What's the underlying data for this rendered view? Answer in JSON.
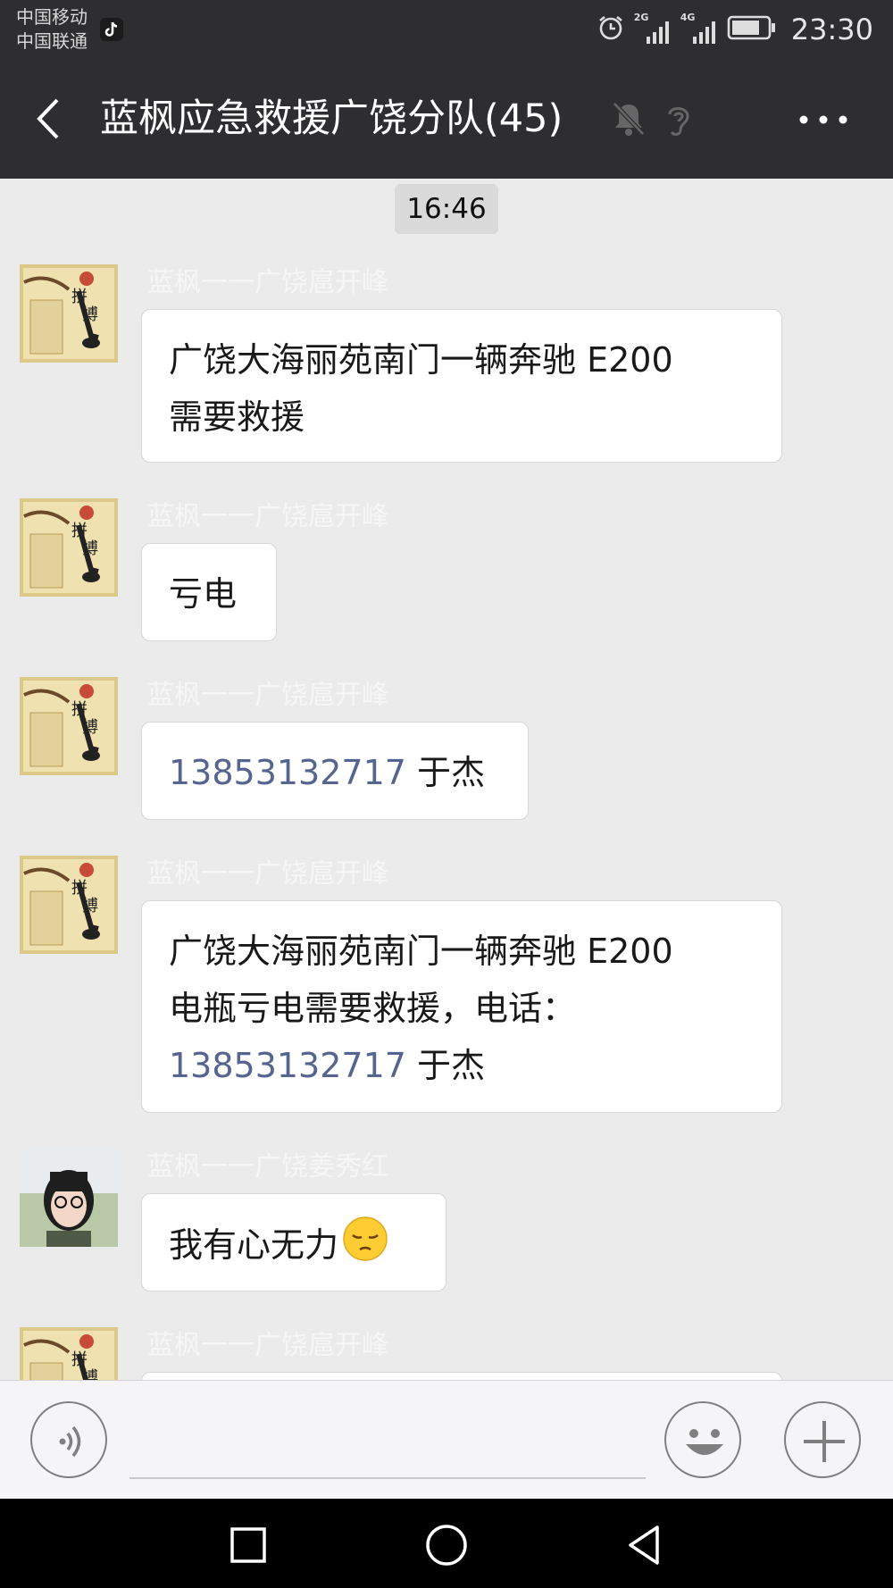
{
  "status_bar": {
    "carrier1": "中国移动",
    "carrier2": "中国联通",
    "net1": "2G",
    "net2": "4G",
    "time": "23:30",
    "icons": [
      "tiktok-icon",
      "alarm-icon",
      "signal-icon",
      "battery-icon"
    ]
  },
  "header": {
    "title": "蓝枫应急救援广饶分队(45)",
    "icons": [
      "back-arrow-icon",
      "mute-bell-icon",
      "earpiece-icon",
      "more-icon"
    ]
  },
  "chat": {
    "timestamp": "16:46",
    "messages": [
      {
        "sender": "蓝枫一一广饶扈开峰",
        "line1": "广饶大海丽苑南门一辆奔驰 E200",
        "line2": "需要救援"
      },
      {
        "sender": "蓝枫一一广饶扈开峰",
        "text": "亏电"
      },
      {
        "sender": "蓝枫一一广饶扈开峰",
        "phone": "13853132717",
        "suffix": " 于杰"
      },
      {
        "sender": "蓝枫一一广饶扈开峰",
        "line1": "广饶大海丽苑南门一辆奔驰 E200",
        "line2": "电瓶亏电需要救援，电话：",
        "phone": "13853132717",
        "suffix": " 于杰"
      },
      {
        "sender": "蓝枫一一广饶姜秀红",
        "text": "我有心无力",
        "emoji": "pensive-face"
      },
      {
        "sender": "蓝枫一一广饶扈开峰"
      }
    ]
  },
  "input_bar": {
    "text_value": "",
    "icons": [
      "voice-icon",
      "smiley-icon",
      "plus-icon"
    ]
  },
  "nav_bar": {
    "icons": [
      "recents-square-icon",
      "home-circle-icon",
      "back-triangle-icon"
    ]
  },
  "colors": {
    "header_bg": "#2e2e30",
    "chat_bg": "#ebebeb",
    "bubble_bg": "#ffffff",
    "phone_link": "#56658f",
    "sender_name": "#f6f6f6"
  }
}
